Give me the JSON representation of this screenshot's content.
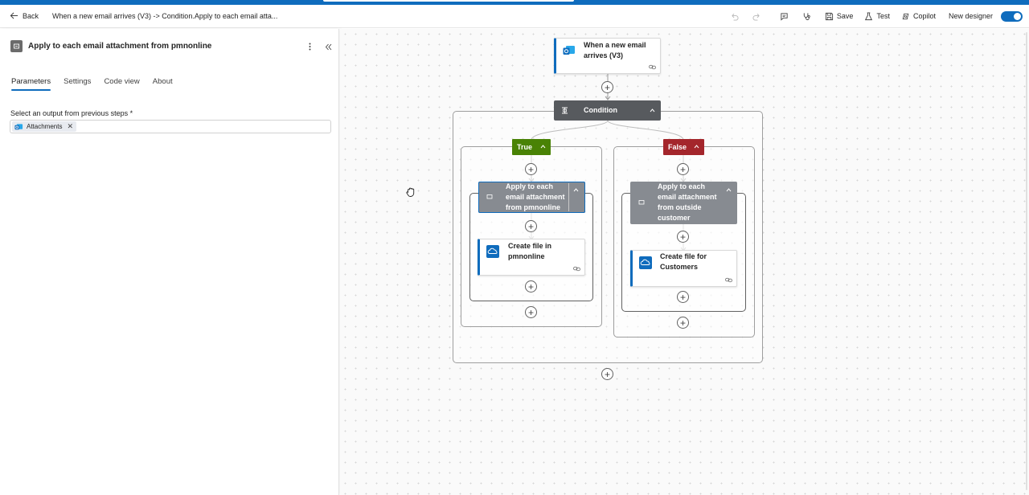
{
  "header": {
    "back_label": "Back",
    "breadcrumb": "When a new email arrives (V3) -> Condition.Apply to each email atta...",
    "save_label": "Save",
    "test_label": "Test",
    "copilot_label": "Copilot",
    "new_designer_label": "New designer",
    "new_designer_enabled": true
  },
  "panel": {
    "title": "Apply to each email attachment from pmnonline",
    "tabs": [
      {
        "label": "Parameters",
        "active": true
      },
      {
        "label": "Settings",
        "active": false
      },
      {
        "label": "Code view",
        "active": false
      },
      {
        "label": "About",
        "active": false
      }
    ],
    "field_label": "Select an output from previous steps *",
    "token_label": "Attachments"
  },
  "flow": {
    "trigger": {
      "line1": "When a new email",
      "line2": "arrives (V3)"
    },
    "condition_label": "Condition",
    "true_label": "True",
    "false_label": "False",
    "true_loop": {
      "line1": "Apply to each",
      "line2": "email attachment",
      "line3": "from pmnonline"
    },
    "true_action": {
      "line1": "Create file in",
      "line2": "pmnonline"
    },
    "false_loop": {
      "line1": "Apply to each",
      "line2": "email attachment",
      "line3": "from outside",
      "line4": "customer"
    },
    "false_action": {
      "line1": "Create file for",
      "line2": "Customers"
    }
  },
  "colors": {
    "accent": "#0f6cbd",
    "true_branch": "#498205",
    "false_branch": "#a4262c",
    "condition_header": "#575a5e",
    "loop_header": "#878b91"
  }
}
